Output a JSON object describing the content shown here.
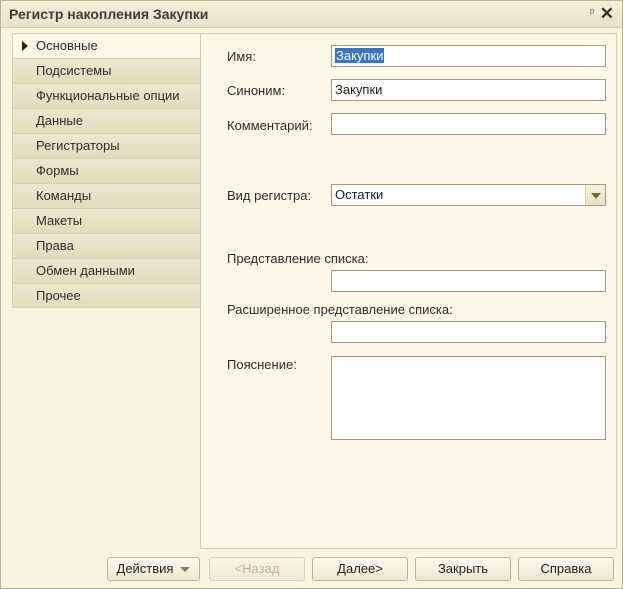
{
  "window": {
    "title": "Регистр накопления Закупки"
  },
  "tabs": [
    {
      "label": "Основные",
      "active": true
    },
    {
      "label": "Подсистемы"
    },
    {
      "label": "Функциональные опции"
    },
    {
      "label": "Данные"
    },
    {
      "label": "Регистраторы"
    },
    {
      "label": "Формы"
    },
    {
      "label": "Команды"
    },
    {
      "label": "Макеты"
    },
    {
      "label": "Права"
    },
    {
      "label": "Обмен данными"
    },
    {
      "label": "Прочее"
    }
  ],
  "form": {
    "name_label": "Имя:",
    "name_value": "Закупки",
    "synonym_label": "Синоним:",
    "synonym_value": "Закупки",
    "comment_label": "Комментарий:",
    "comment_value": "",
    "register_kind_label": "Вид регистра:",
    "register_kind_value": "Остатки",
    "list_presentation_label": "Представление списка:",
    "list_presentation_value": "",
    "ext_list_presentation_label": "Расширенное представление списка:",
    "ext_list_presentation_value": "",
    "explanation_label": "Пояснение:",
    "explanation_value": ""
  },
  "buttons": {
    "actions": "Действия",
    "back": "<Назад",
    "next": "Далее>",
    "close": "Закрыть",
    "help": "Справка"
  },
  "icons": {
    "pin": "pin-icon",
    "close": "close-icon"
  },
  "colors": {
    "background": "#f7f4df",
    "selection": "#3b73c5"
  }
}
